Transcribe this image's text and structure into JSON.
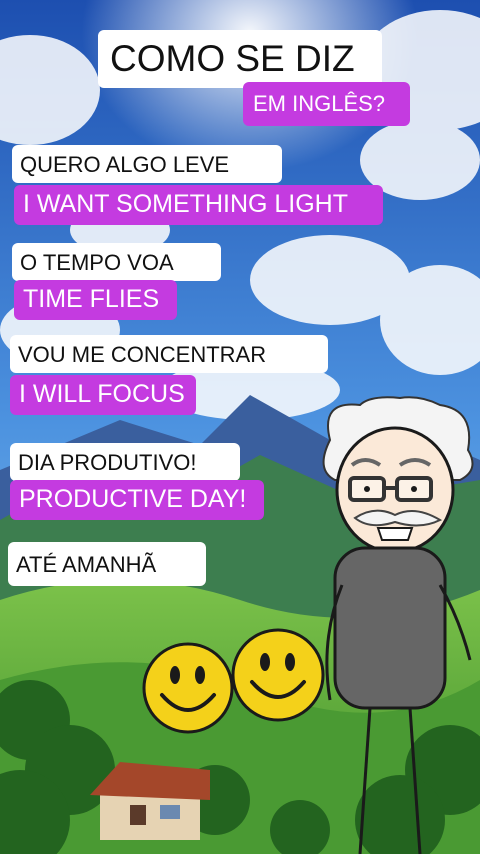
{
  "header": {
    "title": "COMO SE DIZ",
    "subtitle": "EM INGLÊS?"
  },
  "phrases": [
    {
      "portuguese": "QUERO ALGO LEVE",
      "english": "I WANT SOMETHING LIGHT"
    },
    {
      "portuguese": "O TEMPO VOA",
      "english": "TIME FLIES"
    },
    {
      "portuguese": "VOU ME CONCENTRAR",
      "english": "I WILL FOCUS"
    },
    {
      "portuguese": "DIA PRODUTIVO!",
      "english": "PRODUCTIVE DAY!"
    },
    {
      "portuguese": "ATÉ AMANHÃ"
    }
  ],
  "colors": {
    "label_bg": "#ffffff",
    "translation_bg": "#c43be0",
    "sky": "#3f7fd6",
    "grass": "#5aa83a",
    "smiley": "#f4d11a"
  }
}
